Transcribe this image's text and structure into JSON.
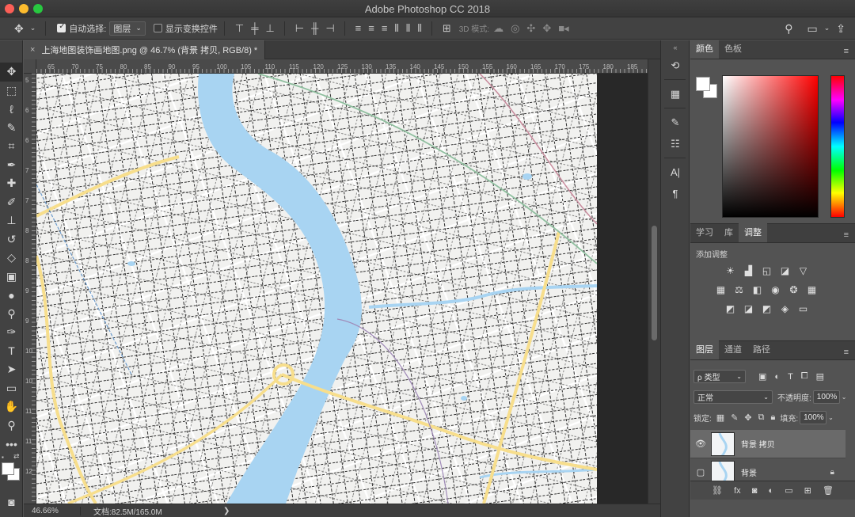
{
  "window": {
    "title": "Adobe Photoshop CC 2018"
  },
  "options_bar": {
    "auto_select_label": "自动选择:",
    "auto_select_value": "图层",
    "show_transform_label": "显示变换控件",
    "mode_3d_label": "3D 模式:"
  },
  "document": {
    "tab_title": "上海地图装饰画地图.png @ 46.7% (背景 拷贝, RGB/8) *",
    "close_glyph": "×",
    "ruler_ticks": [
      "65",
      "70",
      "75",
      "80",
      "85",
      "90",
      "95",
      "100",
      "105",
      "110",
      "115",
      "120",
      "125",
      "130",
      "135",
      "140",
      "145",
      "150",
      "155",
      "160",
      "165",
      "170",
      "175",
      "180",
      "185"
    ],
    "ruler_left": [
      "5",
      "6",
      "6",
      "7",
      "7",
      "8",
      "8",
      "9",
      "9",
      "10",
      "10",
      "11",
      "11",
      "12"
    ]
  },
  "status": {
    "zoom": "46.66%",
    "doc_size": "文档:82.5M/165.0M",
    "arrow": "❯"
  },
  "color_panel": {
    "tabs": [
      "颜色",
      "色板"
    ]
  },
  "adjust_panel": {
    "tabs": [
      "学习",
      "库",
      "调整"
    ],
    "add_label": "添加调整"
  },
  "layers_panel": {
    "tabs": [
      "图层",
      "通道",
      "路径"
    ],
    "filter_kind": "ρ 类型",
    "blend_mode": "正常",
    "opacity_label": "不透明度:",
    "opacity_value": "100%",
    "lock_label": "锁定:",
    "fill_label": "填充:",
    "fill_value": "100%",
    "layers": [
      {
        "name": "背景 拷贝",
        "visible": true,
        "selected": true
      },
      {
        "name": "背景",
        "visible": false,
        "locked": true
      }
    ]
  },
  "colors": {
    "panel_bg": "#535353",
    "chrome_dark": "#424242",
    "river": "#a8d4f2",
    "map_bg": "#f1f1ef",
    "major_road": "#f7de8c"
  }
}
